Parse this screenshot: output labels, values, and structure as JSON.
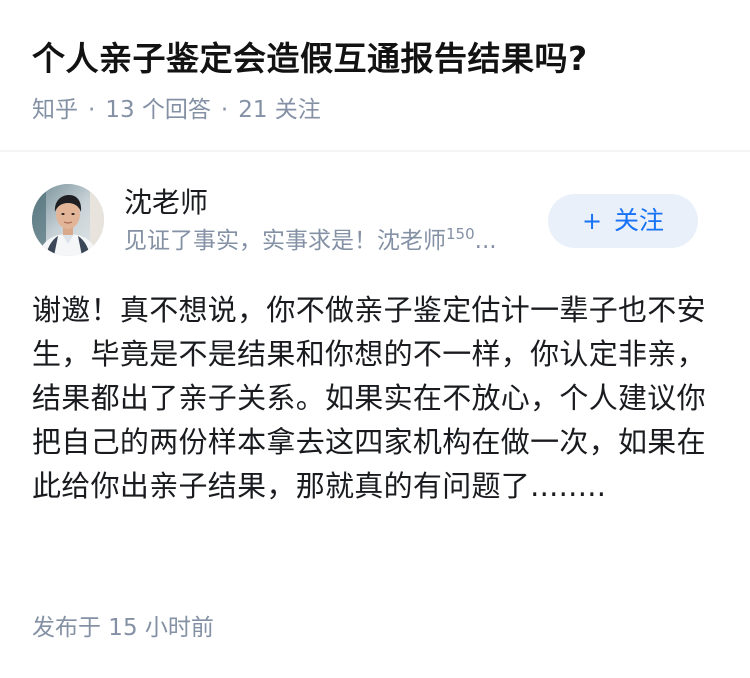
{
  "question": {
    "title": "个人亲子鉴定会造假互通报告结果吗?",
    "source": "知乎",
    "separator": "·",
    "answer_count": "13 个回答",
    "follower_count": "21 关注"
  },
  "author": {
    "name": "沈老师",
    "bio_text": "见证了事实，实事求是！沈老师",
    "bio_sup": "150",
    "bio_ellipsis": "...",
    "avatar_icon": "person-avatar",
    "follow_label": "关注",
    "follow_icon": "plus-icon"
  },
  "answer": {
    "content": "谢邀！真不想说，你不做亲子鉴定估计一辈子也不安生，毕竟是不是结果和你想的不一样，你认定非亲，结果都出了亲子关系。如果实在不放心，个人建议你把自己的两份样本拿去这四家机构在做一次，如果在此给你出亲子结果，那就真的有问题了........",
    "posted_time": "发布于  15 小时前"
  },
  "colors": {
    "accent": "#1772f6",
    "follow_bg": "#e9f0f9",
    "meta_text": "#8491a5",
    "title_text": "#121212"
  }
}
